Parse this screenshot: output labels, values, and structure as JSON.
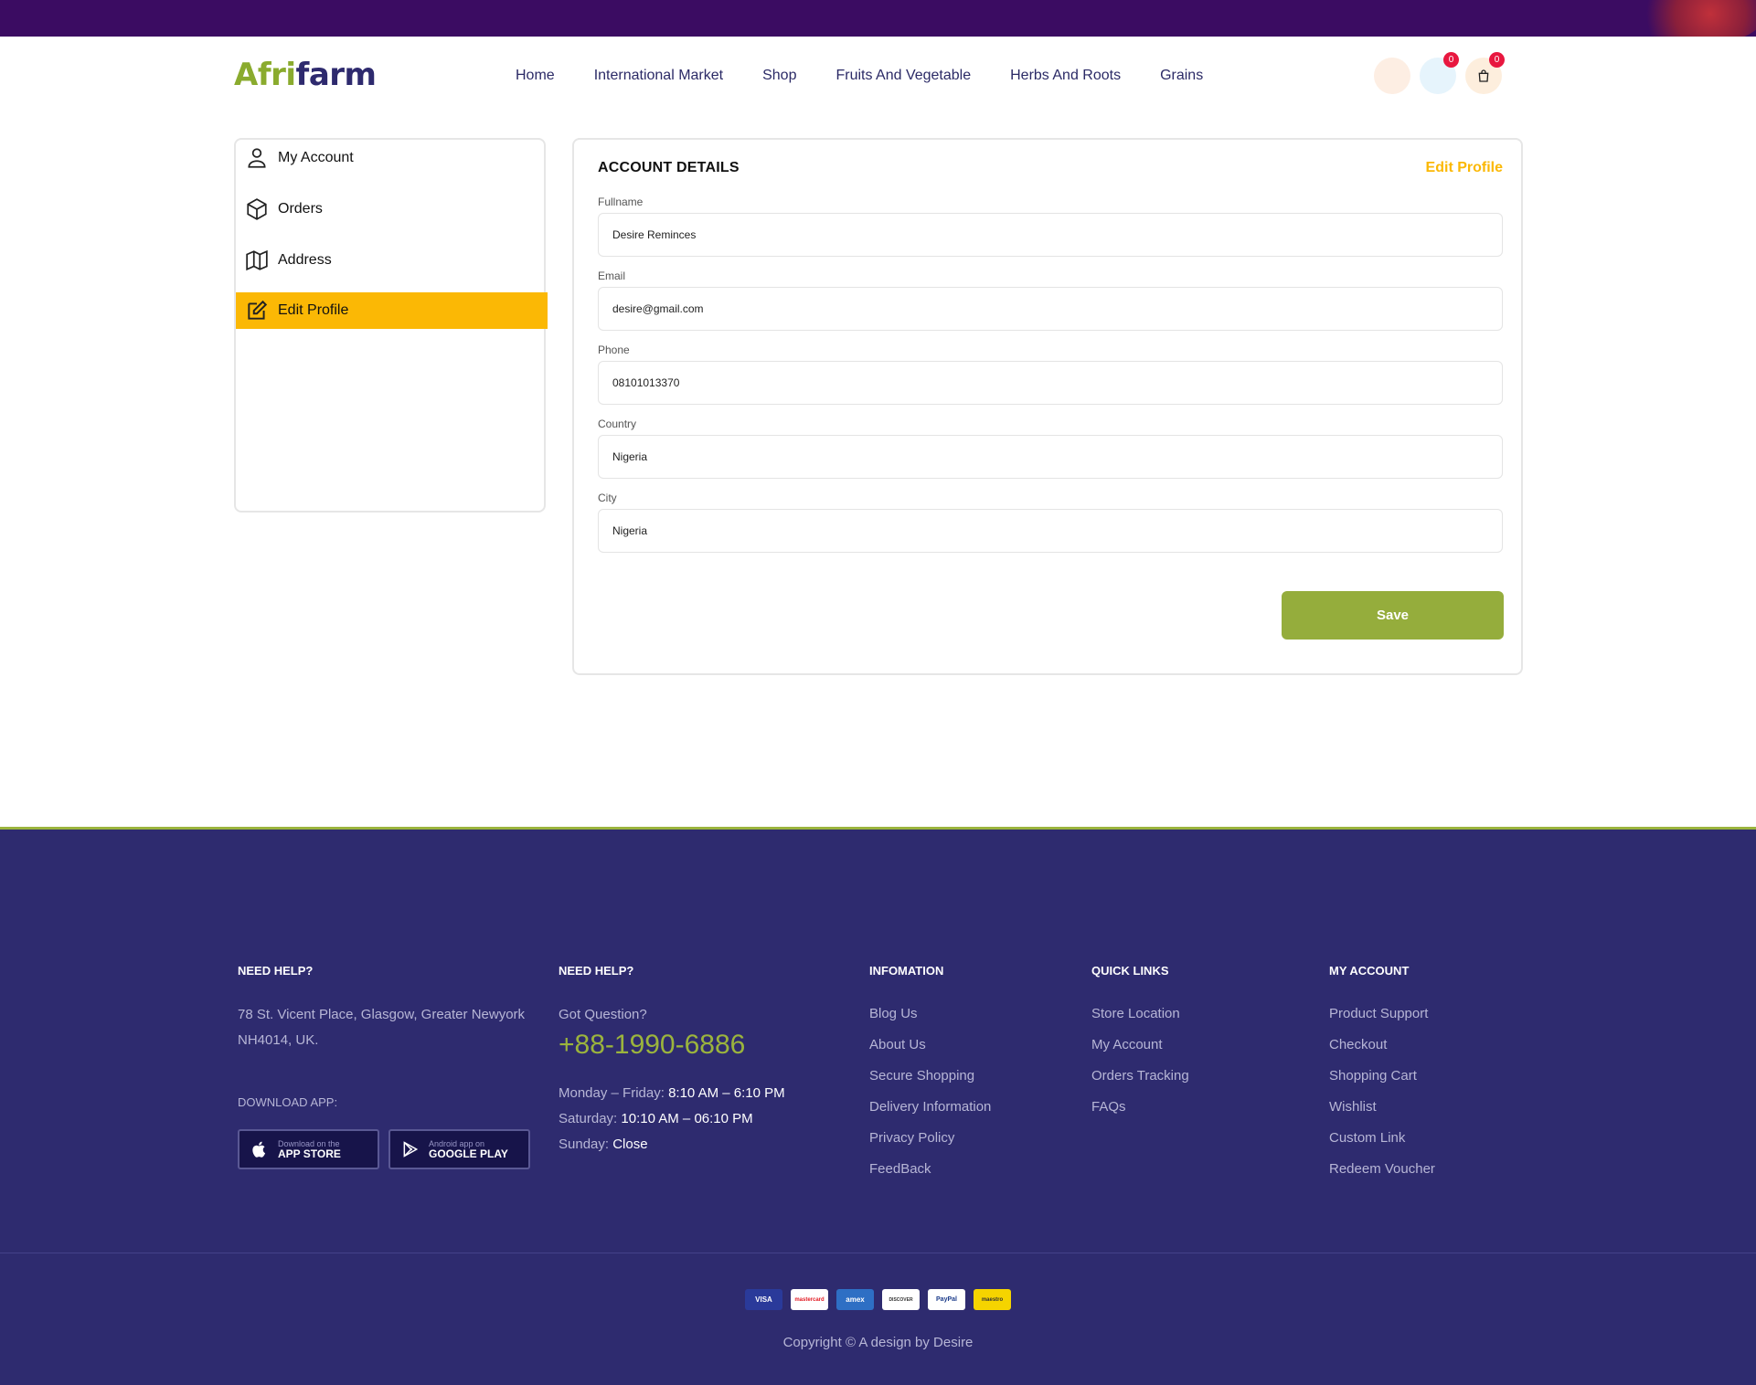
{
  "brand": {
    "logo_part1": "Afri",
    "logo_part2": "farm",
    "green": "#8aab2e",
    "navy": "#2e2a6e",
    "accent": "#fbb805"
  },
  "nav": [
    "Home",
    "International Market",
    "Shop",
    "Fruits And Vegetable",
    "Herbs And Roots",
    "Grains"
  ],
  "header_icons": {
    "user": "user-icon",
    "wishlist_count": "0",
    "cart_count": "0",
    "cart_icon": "shopping-bag-icon"
  },
  "sidebar": {
    "items": [
      {
        "label": "My Account",
        "icon": "user-icon"
      },
      {
        "label": "Orders",
        "icon": "box-icon"
      },
      {
        "label": "Address",
        "icon": "map-icon"
      },
      {
        "label": "Edit Profile",
        "icon": "edit-icon",
        "active": true
      }
    ]
  },
  "panel": {
    "title": "ACCOUNT DETAILS",
    "edit_link": "Edit Profile",
    "fields": [
      {
        "label": "Fullname",
        "value": "Desire Reminces"
      },
      {
        "label": "Email",
        "value": "desire@gmail.com"
      },
      {
        "label": "Phone",
        "value": "08101013370"
      },
      {
        "label": "Country",
        "value": "Nigeria"
      },
      {
        "label": "City",
        "value": "Nigeria"
      }
    ],
    "save_label": "Save"
  },
  "footer": {
    "col1": {
      "heading": "NEED HELP?",
      "address": "78 St. Vicent Place, Glasgow, Greater Newyork NH4014, UK.",
      "download": "DOWNLOAD APP:",
      "appstore_small": "Download on the",
      "appstore_big": "APP STORE",
      "play_small": "Android app on",
      "play_big": "GOOGLE PLAY"
    },
    "col2": {
      "heading": "NEED HELP?",
      "question": "Got Question?",
      "phone": "+88-1990-6886",
      "weekday_label": "Monday – Friday:",
      "weekday_hours": "8:10 AM – 6:10 PM",
      "saturday_label": "Saturday:",
      "saturday_hours": "10:10 AM – 06:10 PM",
      "sunday_label": "Sunday:",
      "sunday_hours": "Close"
    },
    "col3": {
      "heading": "INFOMATION",
      "links": [
        "Blog Us",
        "About Us",
        "Secure Shopping",
        "Delivery Information",
        "Privacy Policy",
        "FeedBack"
      ]
    },
    "col4": {
      "heading": "QUICK LINKS",
      "links": [
        "Store Location",
        "My Account",
        "Orders Tracking",
        "FAQs"
      ]
    },
    "col5": {
      "heading": "MY ACCOUNT",
      "links": [
        "Product Support",
        "Checkout",
        "Shopping Cart",
        "Wishlist",
        "Custom Link",
        "Redeem Voucher"
      ]
    },
    "payments": [
      "VISA",
      "mastercard",
      "amex",
      "DISCOVER",
      "PayPal",
      "maestro"
    ],
    "copyright": "Copyright © A design by Desire"
  }
}
